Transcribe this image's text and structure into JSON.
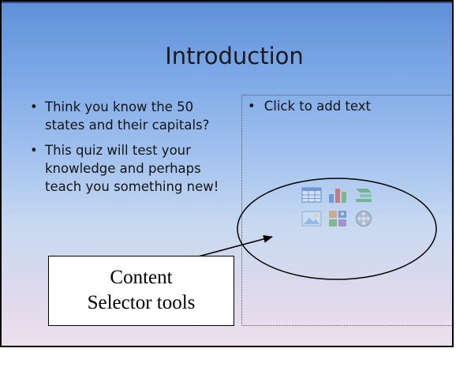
{
  "slide": {
    "title": "Introduction",
    "left_bullets": [
      "Think you know the 50 states and their capitals?",
      "This quiz will test your knowledge and perhaps teach you something new!"
    ],
    "placeholder_text": "Click to add text",
    "bullet_char": "•"
  },
  "content_icons": [
    "insert-table-icon",
    "insert-chart-icon",
    "insert-smartart-icon",
    "insert-picture-icon",
    "insert-clipart-icon",
    "insert-media-icon"
  ],
  "callout": {
    "line1": "Content",
    "line2": "Selector tools"
  },
  "colors": {
    "slide_top": "#5f8fd8",
    "slide_bottom": "#ece0ee",
    "callout_border": "#000000"
  }
}
